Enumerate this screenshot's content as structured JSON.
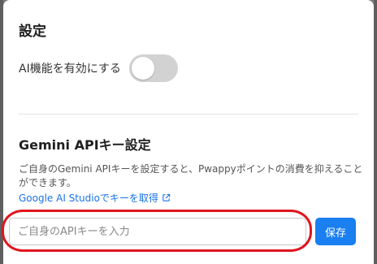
{
  "dialog": {
    "title": "設定"
  },
  "ai_setting": {
    "label": "AI機能を有効にする",
    "enabled": false
  },
  "gemini": {
    "section_title": "Gemini APIキー設定",
    "description": "ご自身のGemini APIキーを設定すると、Pwappyポイントの消費を抑えることができます。",
    "link_text": "Google AI Studioでキーを取得",
    "link_icon": "external-link-icon",
    "input_placeholder": "ご自身のAPIキーを入力",
    "input_value": "",
    "save_label": "保存"
  },
  "colors": {
    "accent": "#1a7ff0",
    "link": "#1a73e8",
    "annotation_ring": "#e0141e",
    "toggle_off": "#d2d2d2"
  }
}
